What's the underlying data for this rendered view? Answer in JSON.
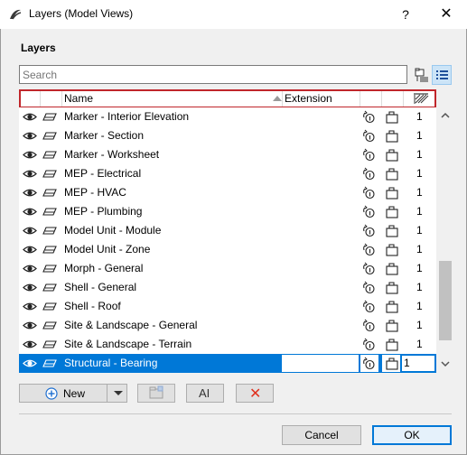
{
  "window": {
    "title": "Layers (Model Views)",
    "help_glyph": "?",
    "close_glyph": "✕"
  },
  "section_title": "Layers",
  "search": {
    "placeholder": "Search",
    "value": ""
  },
  "columns": {
    "name": "Name",
    "extension": "Extension"
  },
  "layers": [
    {
      "name": "Marker - Interior Elevation",
      "intersection": "1",
      "selected": false
    },
    {
      "name": "Marker - Section",
      "intersection": "1",
      "selected": false
    },
    {
      "name": "Marker - Worksheet",
      "intersection": "1",
      "selected": false
    },
    {
      "name": "MEP - Electrical",
      "intersection": "1",
      "selected": false
    },
    {
      "name": "MEP - HVAC",
      "intersection": "1",
      "selected": false
    },
    {
      "name": "MEP - Plumbing",
      "intersection": "1",
      "selected": false
    },
    {
      "name": "Model Unit - Module",
      "intersection": "1",
      "selected": false
    },
    {
      "name": "Model Unit - Zone",
      "intersection": "1",
      "selected": false
    },
    {
      "name": "Morph - General",
      "intersection": "1",
      "selected": false
    },
    {
      "name": "Shell - General",
      "intersection": "1",
      "selected": false
    },
    {
      "name": "Shell - Roof",
      "intersection": "1",
      "selected": false
    },
    {
      "name": "Site & Landscape - General",
      "intersection": "1",
      "selected": false
    },
    {
      "name": "Site & Landscape - Terrain",
      "intersection": "1",
      "selected": false
    },
    {
      "name": "Structural - Bearing",
      "intersection": "1",
      "selected": true
    }
  ],
  "buttons": {
    "new": "New",
    "rename_glyph": "AI",
    "delete_glyph": "✕",
    "cancel": "Cancel",
    "ok": "OK"
  },
  "colors": {
    "selection": "#0078d7",
    "header_highlight": "#c0262b",
    "delete_icon": "#e0301e",
    "new_icon": "#1e6fd0"
  },
  "scroll": {
    "position_fraction": 0.8
  }
}
